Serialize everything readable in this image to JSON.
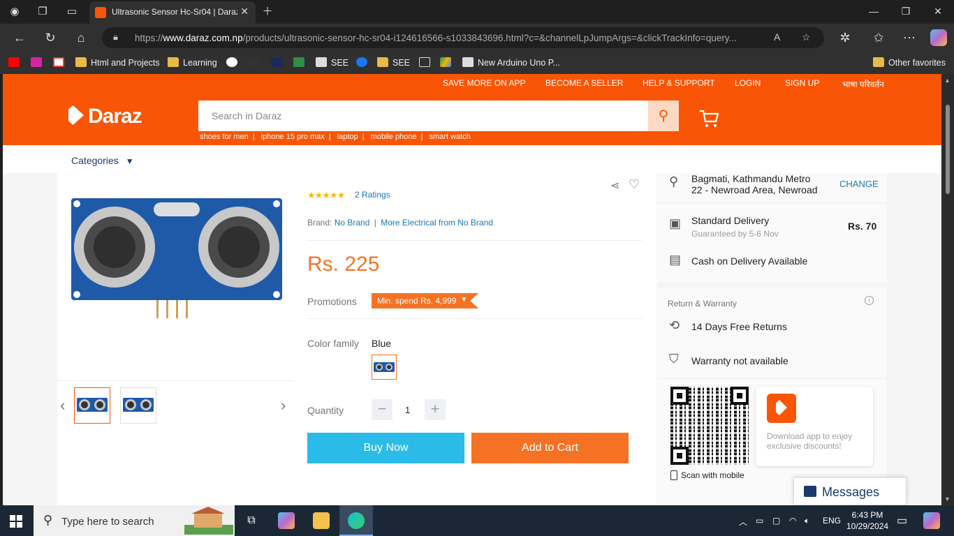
{
  "browser": {
    "tab_title": "Ultrasonic Sensor Hc-Sr04 | Daraz",
    "url_prefix": "https://",
    "url_domain": "www.daraz.com.np",
    "url_path": "/products/ultrasonic-sensor-hc-sr04-i124616566-s1033843696.html?c=&channelLpJumpArgs=&clickTrackInfo=query...",
    "bookmarks": [
      "Html and Projects",
      "Learning",
      "SEE",
      "SEE",
      "New Arduino Uno P..."
    ],
    "other_favorites": "Other favorites"
  },
  "header": {
    "top_links": [
      "SAVE MORE ON APP",
      "BECOME A SELLER",
      "HELP & SUPPORT",
      "LOGIN",
      "SIGN UP",
      "भाषा परिवर्तन"
    ],
    "logo": "Daraz",
    "search_placeholder": "Search in Daraz",
    "search_hints": [
      "shoes for men",
      "iphone 15 pro max",
      "laptop",
      "mobile phone",
      "smart watch"
    ],
    "categories_label": "Categories"
  },
  "product": {
    "ratings_text": "2 Ratings",
    "brand_label": "Brand:",
    "brand": "No Brand",
    "more_from": "More Electrical from No Brand",
    "price": "Rs. 225",
    "promotions_label": "Promotions",
    "promotion_tag": "Min. spend Rs. 4,999",
    "color_label": "Color family",
    "color_value": "Blue",
    "quantity_label": "Quantity",
    "quantity": "1",
    "buy_now": "Buy Now",
    "add_to_cart": "Add to Cart"
  },
  "delivery": {
    "location_line1": "Bagmati, Kathmandu Metro",
    "location_line2": "22 - Newroad Area, Newroad",
    "change": "CHANGE",
    "standard": "Standard Delivery",
    "guarantee": "Guaranteed by 5-6 Nov",
    "fee": "Rs. 70",
    "cod": "Cash on Delivery Available",
    "return_title": "Return & Warranty",
    "returns": "14 Days Free Returns",
    "warranty": "Warranty not available",
    "app_promo": "Download app to enjoy exclusive discounts!",
    "scan": "Scan with mobile"
  },
  "chat": {
    "label": "Messages"
  },
  "taskbar": {
    "search_placeholder": "Type here to search",
    "lang": "ENG",
    "time": "6:43 PM",
    "date": "10/29/2024"
  }
}
